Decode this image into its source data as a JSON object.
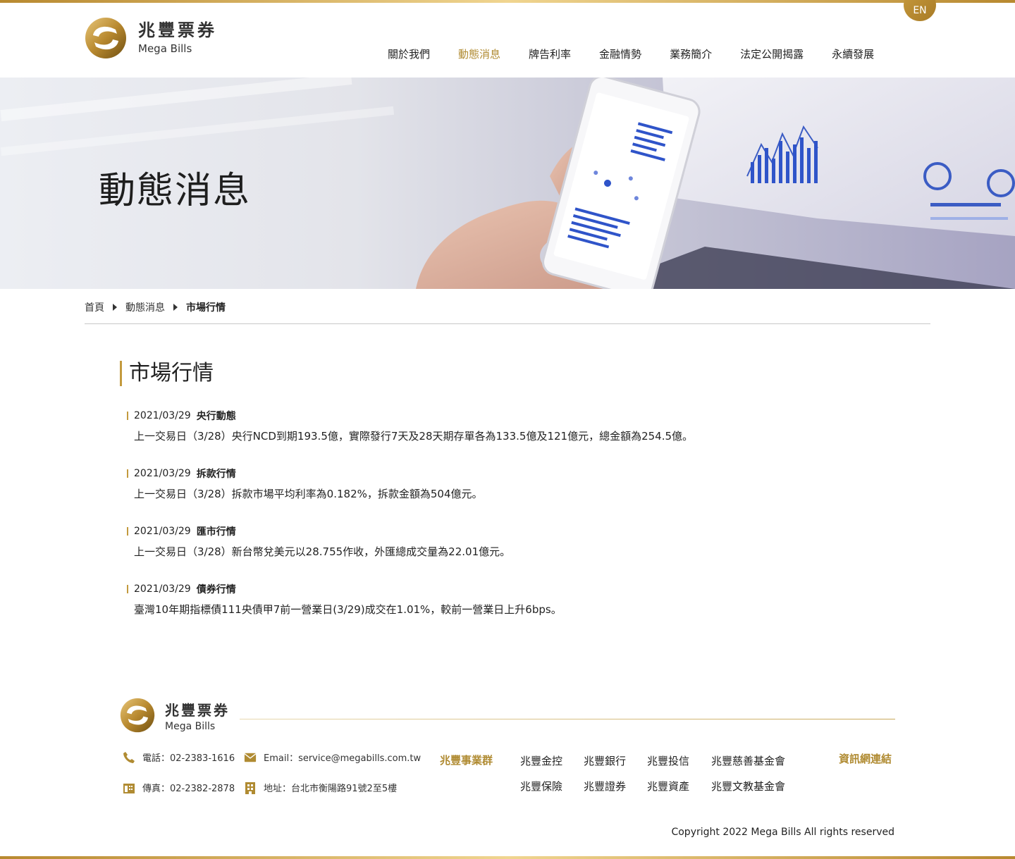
{
  "header": {
    "lang_button": "EN",
    "logo_zh": "兆豐票券",
    "logo_en": "Mega Bills",
    "nav": [
      "關於我們",
      "動態消息",
      "牌告利率",
      "金融情勢",
      "業務簡介",
      "法定公開揭露",
      "永續發展"
    ],
    "active_nav": "動態消息"
  },
  "banner": {
    "title": "動態消息"
  },
  "breadcrumb": [
    "首頁",
    "動態消息",
    "市場行情"
  ],
  "section": {
    "title": "市場行情",
    "items": [
      {
        "date": "2021/03/29",
        "category": "央行動態",
        "text": "上一交易日（3/28）央行NCD到期193.5億，實際發行7天及28天期存單各為133.5億及121億元，總金額為254.5億。"
      },
      {
        "date": "2021/03/29",
        "category": "拆款行情",
        "text": "上一交易日（3/28）拆款市場平均利率為0.182%，拆款金額為504億元。"
      },
      {
        "date": "2021/03/29",
        "category": "匯市行情",
        "text": "上一交易日（3/28）新台幣兌美元以28.755作收，外匯總成交量為22.01億元。"
      },
      {
        "date": "2021/03/29",
        "category": "債券行情",
        "text": "臺灣10年期指標債111央債甲7前一營業日(3/29)成交在1.01%，較前一營業日上升6bps。"
      }
    ]
  },
  "footer": {
    "logo_zh": "兆豐票券",
    "logo_en": "Mega Bills",
    "phone": "電話：02-2383-1616",
    "fax": "傳真：02-2382-2878",
    "email": "Email：service@megabills.com.tw",
    "address": "地址：台北市衡陽路91號2至5樓",
    "group_title": "兆豐事業群",
    "group_links": [
      "兆豐金控",
      "兆豐銀行",
      "兆豐投信",
      "兆豐慈善基金會",
      "兆豐保險",
      "兆豐證券",
      "兆豐資產",
      "兆豐文教基金會"
    ],
    "info_link": "資訊網連結",
    "copyright": "Copyright 2022 Mega Bills All rights reserved"
  },
  "colors": {
    "gold": "#b08b32",
    "gold_light": "#f0d590",
    "text": "#222222"
  }
}
